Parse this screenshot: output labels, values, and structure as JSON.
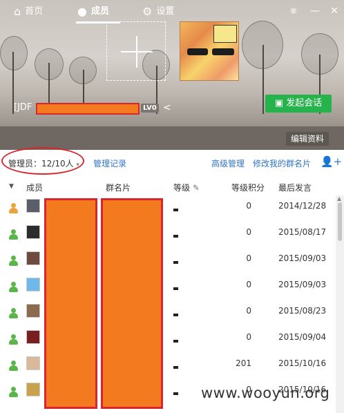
{
  "window": {
    "skin_icon": "skin-icon",
    "minimize": "—",
    "close": "✕"
  },
  "header": {
    "group_prefix": "[JDF",
    "level_badge": "LV0",
    "share_icon": "share-icon",
    "start_chat": "发起会话"
  },
  "tabs": [
    {
      "label": "首页",
      "icon": "home-icon"
    },
    {
      "label": "成员",
      "icon": "member-icon"
    },
    {
      "label": "设置",
      "icon": "gear-icon"
    }
  ],
  "edit_profile": "编辑资料",
  "toolbar": {
    "admin_count": "管理员：12/10人",
    "manage_log": "管理记录",
    "advanced_manage": "高级管理",
    "edit_my_card": "修改我的群名片"
  },
  "columns": {
    "member": "成员",
    "card": "群名片",
    "level": "等级",
    "points": "等级积分",
    "last_speak": "最后发言"
  },
  "rows": [
    {
      "role": "owner",
      "level": "-",
      "points": "0",
      "date": "2014/12/28",
      "thumb": "#5b5f6a"
    },
    {
      "role": "member",
      "level": "-",
      "points": "0",
      "date": "2015/08/17",
      "thumb": "#2c2c2c"
    },
    {
      "role": "member",
      "level": "-",
      "points": "0",
      "date": "2015/09/03",
      "thumb": "#6e4a3f"
    },
    {
      "role": "member",
      "level": "-",
      "points": "0",
      "date": "2015/09/03",
      "thumb": "#6fb9ea"
    },
    {
      "role": "member",
      "level": "-",
      "points": "0",
      "date": "2015/08/23",
      "thumb": "#8b6a4e"
    },
    {
      "role": "member",
      "level": "-",
      "points": "0",
      "date": "2015/09/04",
      "thumb": "#7a1f1f"
    },
    {
      "role": "member",
      "level": "-",
      "points": "201",
      "date": "2015/10/16",
      "thumb": "#d9b99a"
    },
    {
      "role": "member",
      "level": "-",
      "points": "0",
      "date": "2015/10/16",
      "thumb": "#c9a24b"
    }
  ],
  "watermark": "www.wooyun.org",
  "colors": {
    "accent_green": "#27b34b",
    "link_blue": "#2f73c7",
    "redaction_fill": "#f47a20",
    "redaction_border": "#d8262c",
    "owner_icon": "#e8a33a",
    "member_icon": "#5bb64a"
  }
}
